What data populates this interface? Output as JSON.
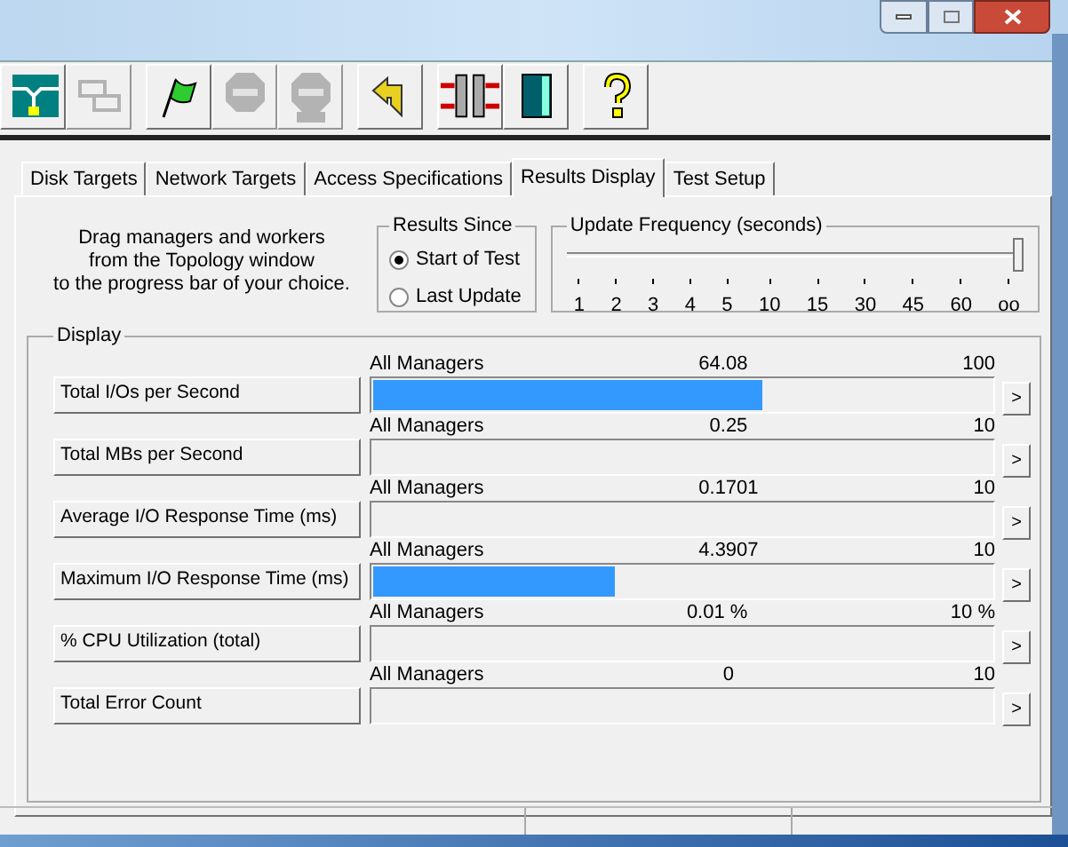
{
  "toolbar": [
    {
      "kind": "topology",
      "disabled": false
    },
    {
      "kind": "workers",
      "disabled": true
    },
    {
      "kind": "flag",
      "disabled": false
    },
    {
      "kind": "stop",
      "disabled": true
    },
    {
      "kind": "stop-all",
      "disabled": true
    },
    {
      "kind": "reset",
      "disabled": false
    },
    {
      "kind": "disconnect",
      "disabled": false
    },
    {
      "kind": "exit",
      "disabled": false
    },
    {
      "kind": "help",
      "disabled": false
    }
  ],
  "tabs": [
    {
      "label": "Disk Targets",
      "selected": false
    },
    {
      "label": "Network Targets",
      "selected": false
    },
    {
      "label": "Access Specifications",
      "selected": false
    },
    {
      "label": "Results Display",
      "selected": true
    },
    {
      "label": "Test Setup",
      "selected": false
    }
  ],
  "instructions": [
    "Drag managers and workers",
    "from the Topology window",
    "to the progress bar of your choice."
  ],
  "results_since": {
    "title": "Results Since",
    "options": [
      {
        "label": "Start of Test",
        "selected": true
      },
      {
        "label": "Last Update",
        "selected": false
      }
    ]
  },
  "update_frequency": {
    "title": "Update Frequency (seconds)",
    "level": 1,
    "ticks": [
      "1",
      "2",
      "3",
      "4",
      "5",
      "10",
      "15",
      "30",
      "45",
      "60",
      "oo"
    ]
  },
  "display": {
    "title": "Display",
    "rows": [
      {
        "label": "Total I/Os per Second",
        "source": "All Managers",
        "value": "64.08",
        "max": "100",
        "level": 0.63,
        "more": ">"
      },
      {
        "label": "Total MBs per Second",
        "source": "All Managers",
        "value": "0.25",
        "max": "10",
        "more": ">"
      },
      {
        "label": "Average I/O Response Time (ms)",
        "source": "All Managers",
        "value": "0.1701",
        "max": "10",
        "more": ">"
      },
      {
        "label": "Maximum I/O Response Time (ms)",
        "source": "All Managers",
        "value": "4.3907",
        "max": "10",
        "level": 0.39,
        "more": ">"
      },
      {
        "label": "% CPU Utilization (total)",
        "source": "All Managers",
        "value": "0.01 %",
        "max": "10 %",
        "more": ">"
      },
      {
        "label": "Total Error Count",
        "source": "All Managers",
        "value": "0",
        "max": "10",
        "more": ">"
      }
    ]
  }
}
